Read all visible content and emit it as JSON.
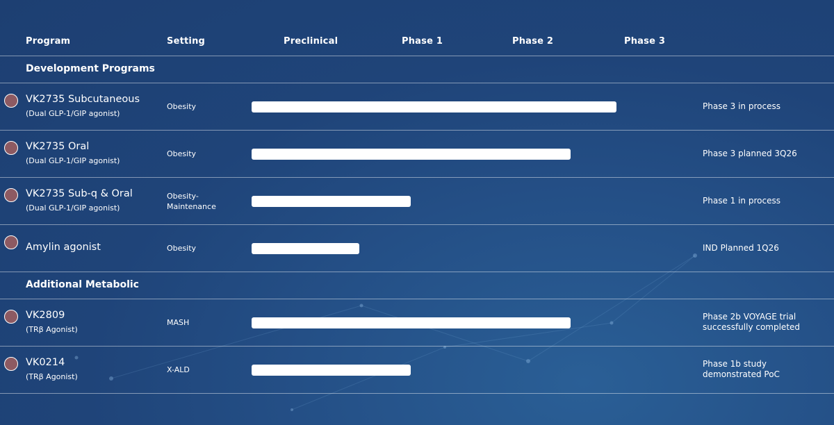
{
  "header": {
    "program": "Program",
    "setting": "Setting",
    "preclinical": "Preclinical",
    "phase1": "Phase 1",
    "phase2": "Phase 2",
    "phase3": "Phase 3"
  },
  "groups": [
    "Development Programs",
    "Additional Metabolic"
  ],
  "chart_data": {
    "type": "bar",
    "orientation": "horizontal",
    "stages": [
      "Preclinical",
      "Phase 1",
      "Phase 2",
      "Phase 3"
    ],
    "categories": [
      "VK2735 Subcutaneous",
      "VK2735 Oral",
      "VK2735 Sub-q & Oral",
      "Amylin agonist",
      "VK2809",
      "VK0214"
    ],
    "values": [
      3.55,
      3.1,
      1.55,
      1.05,
      3.1,
      1.55
    ],
    "xlim": [
      0,
      4
    ],
    "legend": "none",
    "grid": false
  },
  "programs": [
    {
      "group": 0,
      "name": "VK2735 Subcutaneous",
      "sub": "(Dual GLP-1/GIP agonist)",
      "setting": "Obesity",
      "status": "Phase 3 in process",
      "icon": "program-circle-icon"
    },
    {
      "group": 0,
      "name": "VK2735 Oral",
      "sub": "(Dual GLP-1/GIP agonist)",
      "setting": "Obesity",
      "status": "Phase 3 planned 3Q26",
      "icon": "program-circle-icon"
    },
    {
      "group": 0,
      "name": "VK2735 Sub-q & Oral",
      "sub": "(Dual GLP-1/GIP agonist)",
      "setting": "Obesity-\nMaintenance",
      "status": "Phase 1 in process",
      "icon": "program-circle-icon"
    },
    {
      "group": 0,
      "name": "Amylin agonist",
      "sub": "",
      "setting": "Obesity",
      "status": "IND Planned 1Q26",
      "icon": "program-circle-icon"
    },
    {
      "group": 1,
      "name": "VK2809",
      "sub": "(TRβ Agonist)",
      "setting": "MASH",
      "status": "Phase 2b VOYAGE trial\nsuccessfully completed",
      "icon": "program-circle-icon"
    },
    {
      "group": 1,
      "name": "VK0214",
      "sub": "(TRβ Agonist)",
      "setting": "X-ALD",
      "status": "Phase 1b study\ndemonstrated PoC",
      "icon": "program-circle-icon"
    }
  ],
  "colors": {
    "background": "#244f86",
    "bar": "#ffffff",
    "marker": "#8d5a62",
    "divider": "#ffffff"
  }
}
